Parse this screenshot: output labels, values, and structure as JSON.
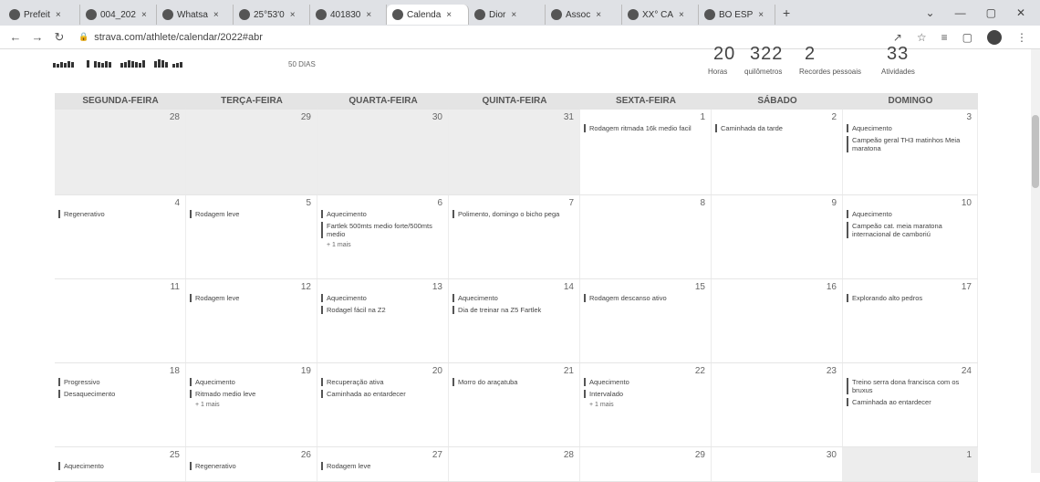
{
  "browser": {
    "tabs": [
      {
        "label": "Prefeit",
        "icon": "facebook-icon"
      },
      {
        "label": "004_202",
        "icon": "globe-icon"
      },
      {
        "label": "Whatsa",
        "icon": "globe-icon"
      },
      {
        "label": "25°53'0",
        "icon": "map-pin-icon"
      },
      {
        "label": "401830",
        "icon": "globe-icon"
      },
      {
        "label": "Calenda",
        "icon": "strava-icon",
        "active": true
      },
      {
        "label": "Dior",
        "icon": "page-icon"
      },
      {
        "label": "Assoc",
        "icon": "translate-icon"
      },
      {
        "label": "XX° CA",
        "icon": "translate-icon"
      },
      {
        "label": "BO ESP",
        "icon": "globe-icon"
      }
    ],
    "url": "strava.com/athlete/calendar/2022#abr"
  },
  "stats": {
    "days_label": "50 DIAS",
    "items": [
      {
        "value": "20",
        "label": "Horas"
      },
      {
        "value": "322",
        "label": "quilômetros"
      },
      {
        "value": "2",
        "label": "Recordes pessoais"
      },
      {
        "value": "33",
        "label": "Atividades"
      }
    ],
    "sparkline": [
      5,
      4,
      6,
      5,
      7,
      6,
      0,
      0,
      8,
      0,
      7,
      6,
      5,
      7,
      6,
      0,
      5,
      6,
      8,
      7,
      6,
      5,
      8,
      0,
      7,
      9,
      8,
      6,
      0,
      4,
      5,
      6
    ]
  },
  "weekdays": [
    "SEGUNDA-FEIRA",
    "TERÇA-FEIRA",
    "QUARTA-FEIRA",
    "QUINTA-FEIRA",
    "SEXTA-FEIRA",
    "SÁBADO",
    "DOMINGO"
  ],
  "weeks": [
    [
      {
        "num": "28",
        "grey": true,
        "events": []
      },
      {
        "num": "29",
        "grey": true,
        "events": []
      },
      {
        "num": "30",
        "grey": true,
        "events": []
      },
      {
        "num": "31",
        "grey": true,
        "events": []
      },
      {
        "num": "1",
        "events": [
          "Rodagem ritmada 16k medio facil"
        ]
      },
      {
        "num": "2",
        "events": [
          "Caminhada da tarde"
        ]
      },
      {
        "num": "3",
        "events": [
          "Aquecimento",
          "Campeão geral TH3 matinhos Meia maratona"
        ]
      }
    ],
    [
      {
        "num": "4",
        "events": [
          "Regenerativo"
        ]
      },
      {
        "num": "5",
        "events": [
          "Rodagem leve"
        ]
      },
      {
        "num": "6",
        "events": [
          "Aquecimento",
          "Fartlek 500mts medio forte/500mts medio"
        ],
        "more": "+ 1 mais"
      },
      {
        "num": "7",
        "events": [
          "Polimento, domingo o bicho pega"
        ]
      },
      {
        "num": "8",
        "events": []
      },
      {
        "num": "9",
        "events": []
      },
      {
        "num": "10",
        "events": [
          "Aquecimento",
          "Campeão cat. meia maratona internacional de camboriú"
        ]
      }
    ],
    [
      {
        "num": "11",
        "events": []
      },
      {
        "num": "12",
        "events": [
          "Rodagem leve"
        ]
      },
      {
        "num": "13",
        "events": [
          "Aquecimento",
          "Rodagel fácil na Z2"
        ]
      },
      {
        "num": "14",
        "events": [
          "Aquecimento",
          "Dia de treinar na Z5 Fartlek"
        ]
      },
      {
        "num": "15",
        "events": [
          "Rodagem descanso ativo"
        ]
      },
      {
        "num": "16",
        "events": []
      },
      {
        "num": "17",
        "events": [
          "Explorando alto pedros"
        ]
      }
    ],
    [
      {
        "num": "18",
        "events": [
          "Progressivo",
          "Desaquecimento"
        ]
      },
      {
        "num": "19",
        "events": [
          "Aquecimento",
          "Ritmado medio leve"
        ],
        "more": "+ 1 mais"
      },
      {
        "num": "20",
        "events": [
          "Recuperação ativa",
          "Caminhada ao entardecer"
        ]
      },
      {
        "num": "21",
        "events": [
          "Morro do araçatuba"
        ]
      },
      {
        "num": "22",
        "events": [
          "Aquecimento",
          "Intervalado"
        ],
        "more": "+ 1 mais"
      },
      {
        "num": "23",
        "events": []
      },
      {
        "num": "24",
        "events": [
          "Treino serra dona francisca com os bruxus",
          "Caminhada ao entardecer"
        ]
      }
    ],
    [
      {
        "num": "25",
        "events": [
          "Aquecimento"
        ]
      },
      {
        "num": "26",
        "events": [
          "Regenerativo"
        ]
      },
      {
        "num": "27",
        "events": [
          "Rodagem leve"
        ]
      },
      {
        "num": "28",
        "events": []
      },
      {
        "num": "29",
        "events": []
      },
      {
        "num": "30",
        "events": []
      },
      {
        "num": "1",
        "grey": true,
        "events": []
      }
    ]
  ]
}
